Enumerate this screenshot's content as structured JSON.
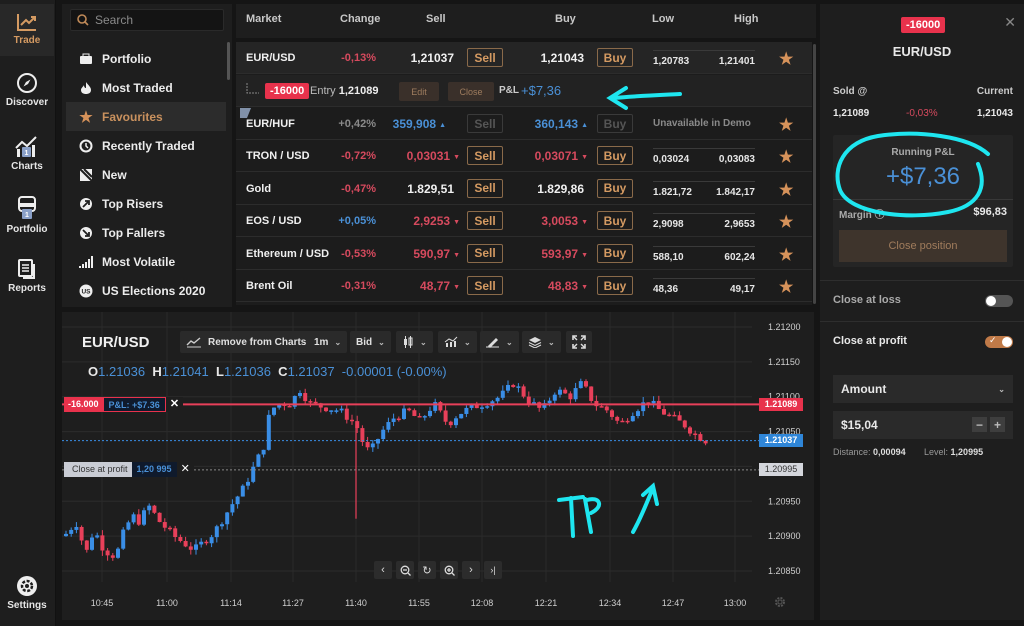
{
  "rail": {
    "items": [
      {
        "label": "Trade",
        "icon": "trade-chart-icon",
        "active": true
      },
      {
        "label": "Discover",
        "icon": "compass-icon"
      },
      {
        "label": "Charts",
        "icon": "charts-icon",
        "badge": "1"
      },
      {
        "label": "Portfolio",
        "icon": "portfolio-icon",
        "badge": "1"
      },
      {
        "label": "Reports",
        "icon": "reports-icon"
      }
    ],
    "settings_label": "Settings"
  },
  "search": {
    "placeholder": "Search"
  },
  "categories": [
    {
      "label": "Portfolio",
      "icon": "briefcase-icon"
    },
    {
      "label": "Most Traded",
      "icon": "flame-icon"
    },
    {
      "label": "Favourites",
      "icon": "star-icon",
      "active": true
    },
    {
      "label": "Recently Traded",
      "icon": "clock-icon"
    },
    {
      "label": "New",
      "icon": "new-icon"
    },
    {
      "label": "Top Risers",
      "icon": "arrow-up-right-icon"
    },
    {
      "label": "Top Fallers",
      "icon": "arrow-down-right-icon"
    },
    {
      "label": "Most Volatile",
      "icon": "signal-bars-icon"
    },
    {
      "label": "US Elections 2020",
      "icon": "us-badge-icon"
    }
  ],
  "market_table": {
    "columns": {
      "market": "Market",
      "change": "Change",
      "sell": "Sell",
      "buy": "Buy",
      "low": "Low",
      "high": "High"
    },
    "sell_label": "Sell",
    "buy_label": "Buy",
    "unavailable_label": "Unavailable in Demo",
    "rows": [
      {
        "name": "EUR/USD",
        "change": "-0,13%",
        "sell": "1,21037",
        "buy": "1,21043",
        "low": "1,20783",
        "high": "1,21401"
      },
      {
        "name": "EUR/HUF",
        "change": "+0,42%",
        "sell": "359,908",
        "buy": "360,143"
      },
      {
        "name": "TRON / USD",
        "change": "-0,72%",
        "sell": "0,03031",
        "buy": "0,03071",
        "low": "0,03024",
        "high": "0,03083"
      },
      {
        "name": "Gold",
        "change": "-0,47%",
        "sell": "1.829,51",
        "buy": "1.829,86",
        "low": "1.821,72",
        "high": "1.842,17"
      },
      {
        "name": "EOS / USD",
        "change": "+0,05%",
        "sell": "2,9253",
        "buy": "3,0053",
        "low": "2,9098",
        "high": "2,9653"
      },
      {
        "name": "Ethereum / USD",
        "change": "-0,53%",
        "sell": "590,97",
        "buy": "593,97",
        "low": "588,10",
        "high": "602,24"
      },
      {
        "name": "Brent Oil",
        "change": "-0,31%",
        "sell": "48,77",
        "buy": "48,83",
        "low": "48,36",
        "high": "49,17"
      }
    ],
    "position": {
      "quantity": "-16000",
      "entry_label": "Entry",
      "entry": "1,21089",
      "edit_label": "Edit",
      "close_label": "Close",
      "pnl_label": "P&L",
      "pnl": "+$7,36"
    }
  },
  "chart": {
    "title": "EUR/USD",
    "toolbar": {
      "remove_label": "Remove from Charts",
      "interval": "1m",
      "price_type": "Bid"
    },
    "ohlc": {
      "o_label": "O",
      "o": "1.21036",
      "h_label": "H",
      "h": "1.21041",
      "l_label": "L",
      "l": "1.21036",
      "c_label": "C",
      "c": "1.21037",
      "change": "-0.00001 (-0.00%)"
    },
    "position_line": {
      "qty": "-16.000",
      "pnl": "P&L: +$7.36",
      "price": "1.21089"
    },
    "current_price": "1.21037",
    "take_profit": {
      "label": "Close at profit",
      "value": "1,20 995",
      "price": "1.20995"
    },
    "y_ticks": [
      "1.21200",
      "1.21150",
      "1.21100",
      "1.21050",
      "1.20950",
      "1.20900",
      "1.20850"
    ],
    "x_ticks": [
      "10:45",
      "11:00",
      "11:14",
      "11:27",
      "11:40",
      "11:55",
      "12:08",
      "12:21",
      "12:34",
      "12:47",
      "13:00"
    ]
  },
  "detail": {
    "quantity": "-16000",
    "market": "EUR/USD",
    "sold_label": "Sold @",
    "current_label": "Current",
    "sold": "1,21089",
    "change": "-0,03%",
    "current": "1,21043",
    "running_label": "Running P&L",
    "running_pnl": "+$7,36",
    "margin_label": "Margin",
    "margin": "$96,83",
    "close_position_label": "Close position",
    "close_at_loss_label": "Close at loss",
    "close_at_loss_on": false,
    "close_at_profit_label": "Close at profit",
    "close_at_profit_on": true,
    "mode": "Amount",
    "amount": "$15,04",
    "distance_label": "Distance:",
    "distance": "0,00094",
    "level_label": "Level:",
    "level": "1,20995"
  },
  "annotations": {
    "tp_text": "TP"
  },
  "colors": {
    "accent": "#d49a62",
    "red": "#e8324c",
    "blue": "#4a90d6",
    "annotation": "#1ee6f0"
  }
}
